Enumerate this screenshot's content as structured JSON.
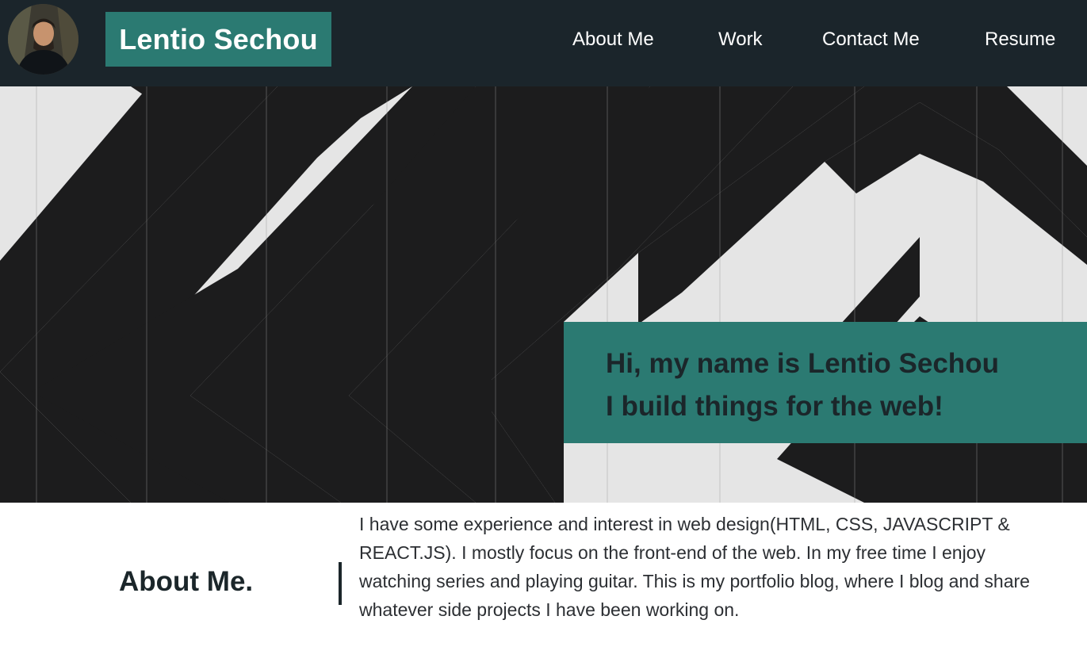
{
  "header": {
    "brand": "Lentio Sechou",
    "nav": {
      "about": "About Me",
      "work": "Work",
      "contact": "Contact Me",
      "resume": "Resume"
    }
  },
  "hero": {
    "line1": "Hi, my name is Lentio Sechou",
    "line2": "I build things for the web!"
  },
  "about": {
    "title": "About Me.",
    "text": "I have some experience and interest in web design(HTML, CSS, JAVASCRIPT & REACT.JS). I mostly focus on the front-end of the web. In my free time I enjoy watching series and playing guitar. This is my portfolio blog, where I blog and share whatever side projects I have been working on."
  },
  "colors": {
    "header_bg": "#1b252b",
    "accent": "#2b7a72",
    "dark_text": "#1b262a"
  },
  "icons": {
    "avatar": "profile-photo"
  }
}
